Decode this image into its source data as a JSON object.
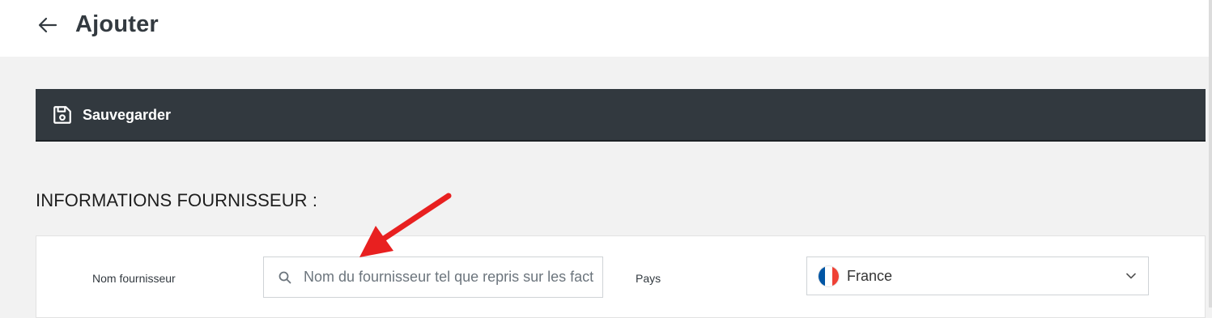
{
  "header": {
    "title": "Ajouter"
  },
  "toolbar": {
    "save_label": "Sauvegarder"
  },
  "section": {
    "title": "INFORMATIONS FOURNISSEUR :"
  },
  "form": {
    "supplier_name": {
      "label": "Nom fournisseur",
      "placeholder": "Nom du fournisseur tel que repris sur les factures",
      "value": ""
    },
    "country": {
      "label": "Pays",
      "value": "France"
    }
  },
  "colors": {
    "toolbar_bg": "#32393f",
    "annotation_arrow": "#e82020",
    "flag_blue": "#0055a4",
    "flag_red": "#ef4135"
  },
  "icons": {
    "back": "arrow-left-icon",
    "save": "floppy-disk-icon",
    "search": "search-icon",
    "dropdown": "chevron-down-icon",
    "flag": "france-flag-icon"
  }
}
